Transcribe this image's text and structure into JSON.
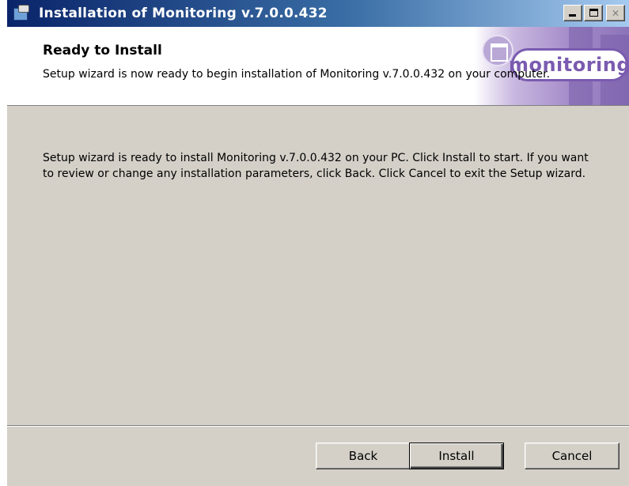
{
  "window": {
    "title": "Installation of Monitoring v.7.0.0.432",
    "icon": "installer-icon"
  },
  "banner": {
    "title": "Ready to Install",
    "description": "Setup wizard is now ready to begin installation of Monitoring v.7.0.0.432 on your computer.",
    "logo_text": "monitoring",
    "accent_color": "#7a5bb0"
  },
  "body": {
    "message": "Setup wizard is ready to install Monitoring v.7.0.0.432 on your PC. Click Install to start. If you want to review or change any installation parameters, click Back. Click Cancel to exit the Setup wizard."
  },
  "buttons": {
    "back": "Back",
    "install": "Install",
    "cancel": "Cancel"
  }
}
